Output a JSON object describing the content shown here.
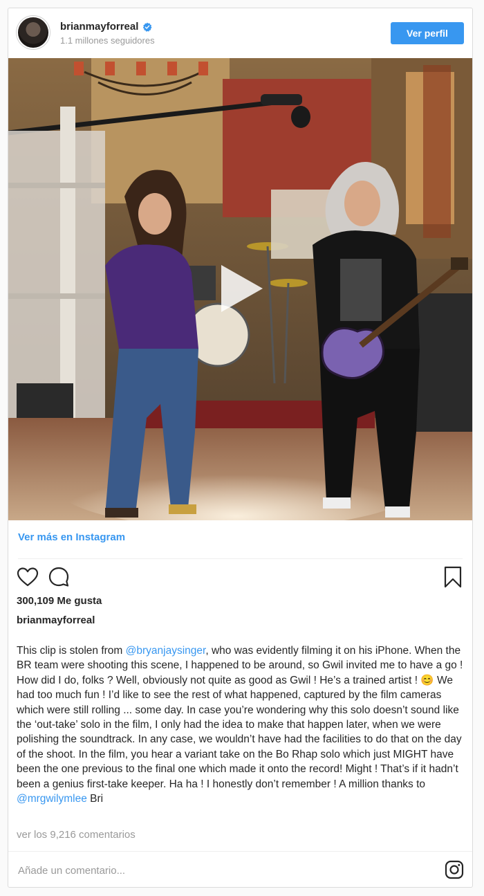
{
  "header": {
    "username": "brianmayforreal",
    "followers": "1.1 millones seguidores",
    "follow_button": "Ver perfil"
  },
  "media": {
    "type": "video",
    "play_icon": "play-icon"
  },
  "view_more_link": "Ver más en Instagram",
  "actions": {
    "like_icon": "heart-icon",
    "comment_icon": "comment-icon",
    "save_icon": "bookmark-icon"
  },
  "likes": "300,109 Me gusta",
  "caption": {
    "author": "brianmayforreal",
    "part1": "This clip is stolen from ",
    "mention1": "@bryanjaysinger",
    "part2": ", who was evidently filming it on his iPhone. When the BR team were shooting this scene, I happened to be around, so Gwil invited me to have a go ! How did I do, folks ? Well, obviously not quite as good as Gwil ! He’s a trained artist ! ",
    "emoji": "😊",
    "part3": " We had too much fun ! I’d like to see the rest of what happened, captured by the film cameras which were still rolling ... some day. In case you’re wondering why this solo doesn’t sound like the ‘out-take’ solo in the film, I only had the idea to make that happen later, when we were polishing the soundtrack. In any case, we wouldn’t have had the facilities to do that on the day of the shoot. In the film, you hear a variant take on the Bo Rhap solo which just MIGHT have been the one previous to the final one which made it onto the record! Might ! That’s if it hadn’t been a genius first-take keeper. Ha ha ! I honestly don’t remember ! A million thanks to ",
    "mention2": "@mrgwilymlee",
    "part4": " Bri"
  },
  "view_comments": "ver los 9,216 comentarios",
  "comment_box": {
    "placeholder": "Añade un comentario...",
    "icon": "instagram-icon"
  },
  "colors": {
    "accent": "#3897f0",
    "text": "#262626",
    "muted": "#999999",
    "border": "#dbdbdb"
  }
}
